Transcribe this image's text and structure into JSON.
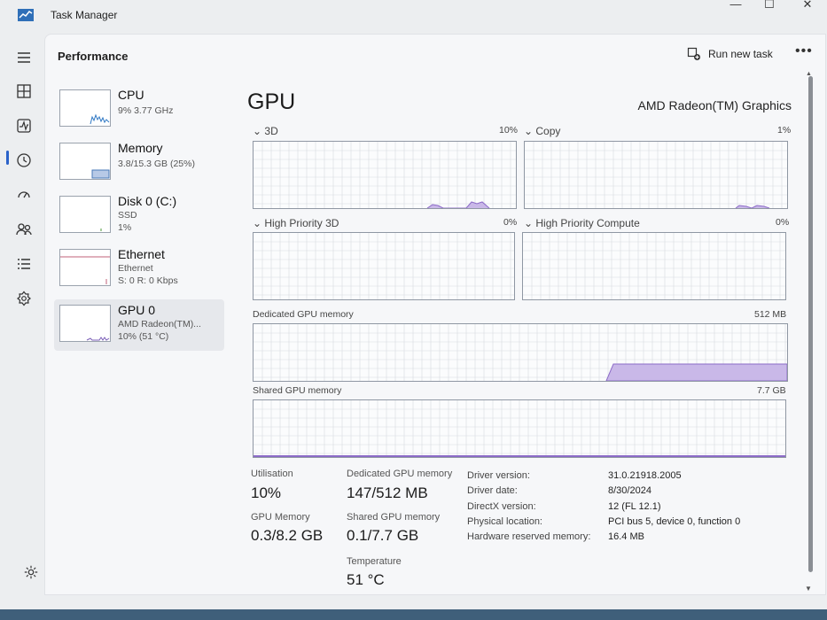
{
  "window": {
    "title": "Task Manager"
  },
  "header": {
    "page_title": "Performance",
    "run_task_label": "Run new task",
    "more_label": "•••"
  },
  "sidebar": {
    "items": [
      {
        "name": "CPU",
        "line1": "9% 3.77 GHz",
        "line2": ""
      },
      {
        "name": "Memory",
        "line1": "3.8/15.3 GB (25%)",
        "line2": ""
      },
      {
        "name": "Disk 0 (C:)",
        "line1": "SSD",
        "line2": "1%"
      },
      {
        "name": "Ethernet",
        "line1": "Ethernet",
        "line2": "S: 0 R: 0 Kbps"
      },
      {
        "name": "GPU 0",
        "line1": "AMD Radeon(TM)...",
        "line2": "10% (51 °C)"
      }
    ]
  },
  "gpu": {
    "title": "GPU",
    "model": "AMD Radeon(TM) Graphics",
    "engines": [
      {
        "label": "3D",
        "percent": "10%"
      },
      {
        "label": "Copy",
        "percent": "1%"
      },
      {
        "label": "High Priority 3D",
        "percent": "0%"
      },
      {
        "label": "High Priority Compute",
        "percent": "0%"
      }
    ],
    "dedicated": {
      "label": "Dedicated GPU memory",
      "max": "512 MB"
    },
    "shared": {
      "label": "Shared GPU memory",
      "max": "7.7 GB"
    }
  },
  "stats": {
    "utilisation": {
      "label": "Utilisation",
      "value": "10%"
    },
    "dedicated_mem": {
      "label": "Dedicated GPU memory",
      "value": "147/512 MB"
    },
    "gpu_memory": {
      "label": "GPU Memory",
      "value": "0.3/8.2 GB"
    },
    "shared_mem": {
      "label": "Shared GPU memory",
      "value": "0.1/7.7 GB"
    },
    "temperature": {
      "label": "Temperature",
      "value": "51 °C"
    }
  },
  "info": [
    {
      "key": "Driver version:",
      "value": "31.0.21918.2005"
    },
    {
      "key": "Driver date:",
      "value": "8/30/2024"
    },
    {
      "key": "DirectX version:",
      "value": "12 (FL 12.1)"
    },
    {
      "key": "Physical location:",
      "value": "PCI bus 5, device 0, function 0"
    },
    {
      "key": "Hardware reserved memory:",
      "value": "16.4 MB"
    }
  ],
  "colors": {
    "accent": "#2a62c9",
    "graph_line": "#8c6bc8",
    "graph_fill": "#c9b8e8",
    "grid": "#d8dbe0"
  }
}
